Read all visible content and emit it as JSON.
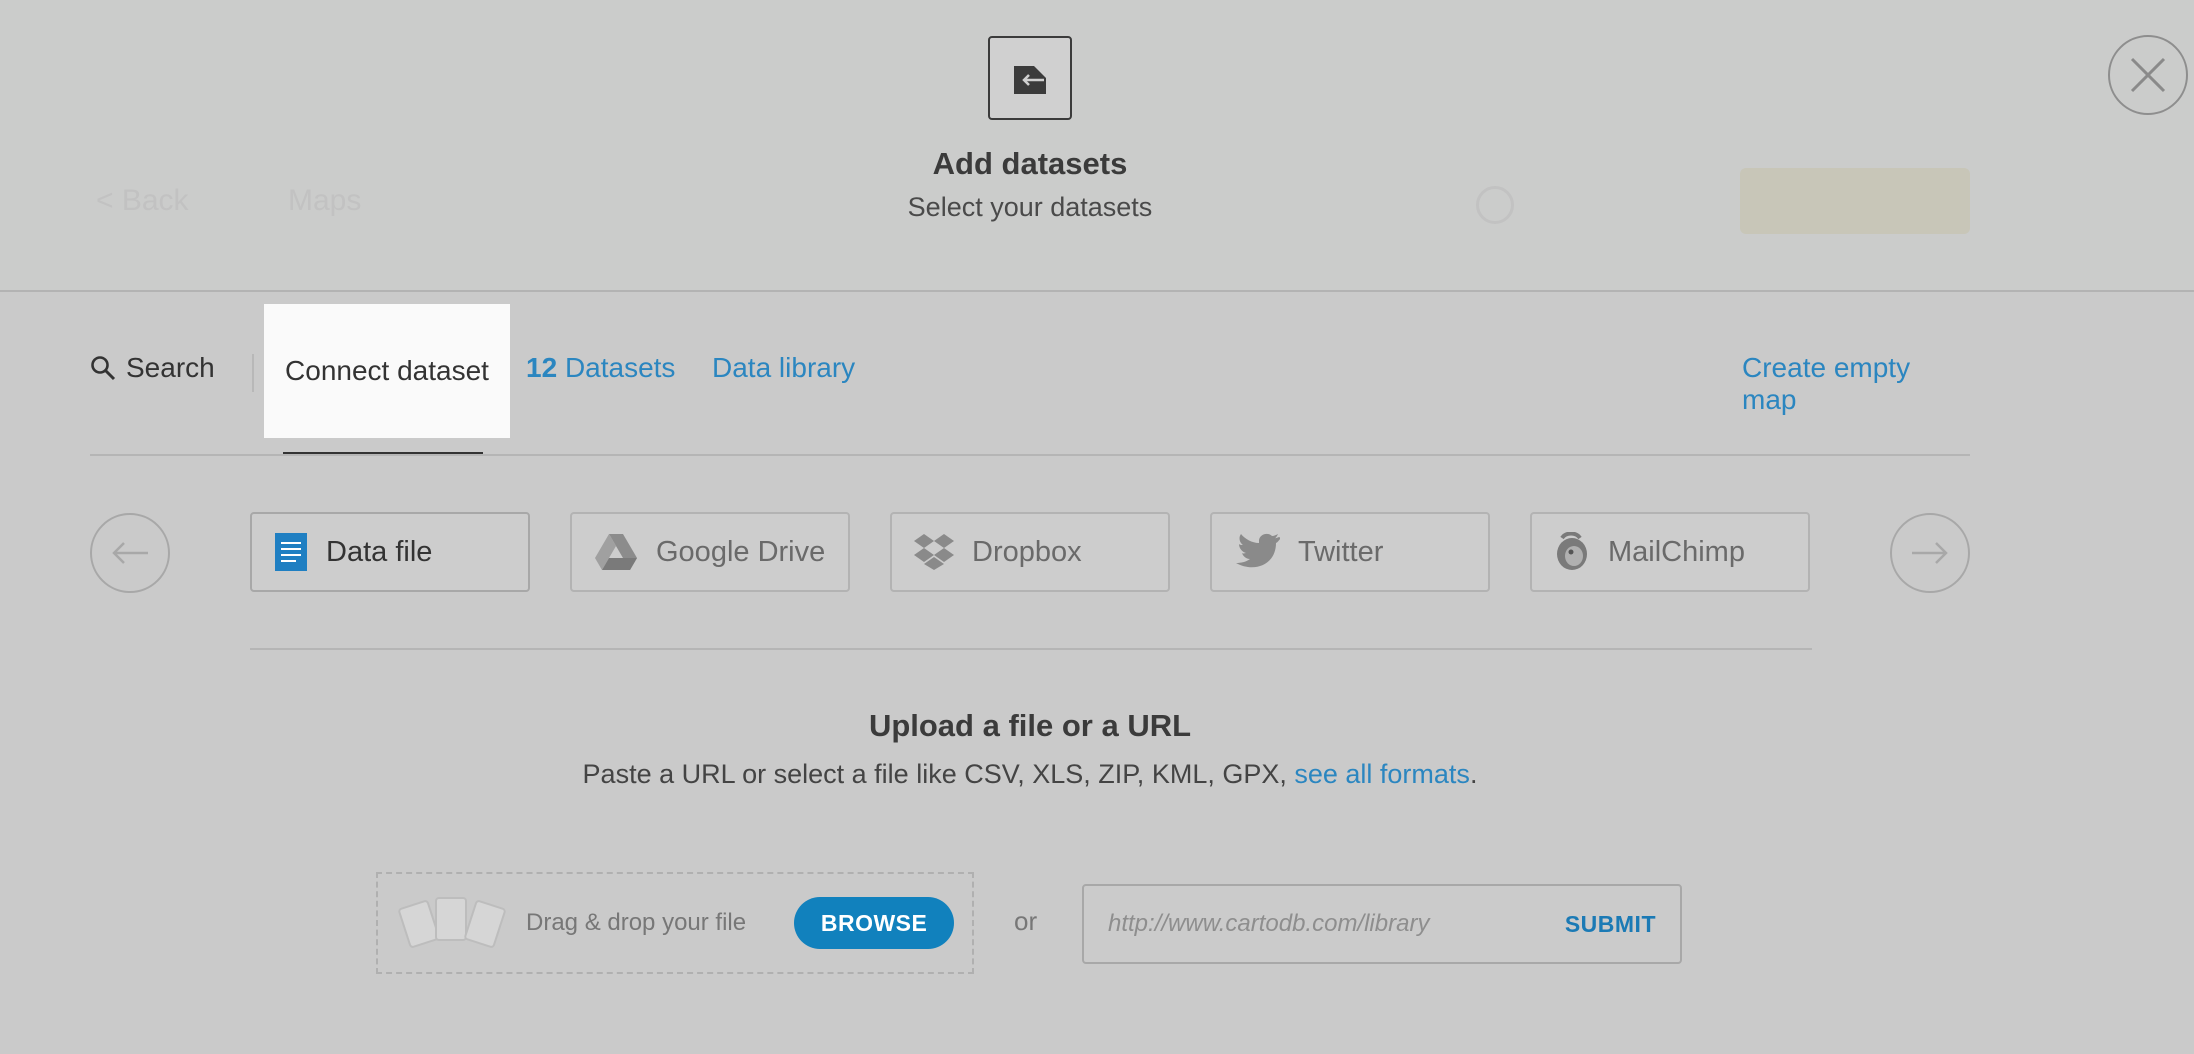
{
  "background": {
    "ghost_back": "< Back",
    "ghost_title": "Maps"
  },
  "modal": {
    "title": "Add datasets",
    "subtitle": "Select your datasets",
    "close_icon": "close-icon",
    "header_icon": "import-icon"
  },
  "nav": {
    "search_label": "Search",
    "tabs": [
      {
        "label": "Connect dataset",
        "active": true
      },
      {
        "count": "12",
        "label": "Datasets"
      },
      {
        "label": "Data library"
      }
    ],
    "create_empty_map": "Create empty map"
  },
  "connectors": [
    {
      "label": "Data file",
      "icon": "document-icon",
      "active": true
    },
    {
      "label": "Google Drive",
      "icon": "google-drive-icon"
    },
    {
      "label": "Dropbox",
      "icon": "dropbox-icon"
    },
    {
      "label": "Twitter",
      "icon": "twitter-icon"
    },
    {
      "label": "MailChimp",
      "icon": "mailchimp-icon"
    }
  ],
  "upload": {
    "title": "Upload a file or a URL",
    "desc_prefix": "Paste a URL or select a file like CSV, XLS, ZIP, KML, GPX, ",
    "desc_link": "see all formats",
    "desc_suffix": ".",
    "drop_text": "Drag & drop your file",
    "browse": "BROWSE",
    "or": "or",
    "url_placeholder": "http://www.cartodb.com/library",
    "submit": "SUBMIT"
  },
  "colors": {
    "link": "#2b86c0",
    "primary_button": "#1181bd",
    "overlay": "#cacaca"
  }
}
